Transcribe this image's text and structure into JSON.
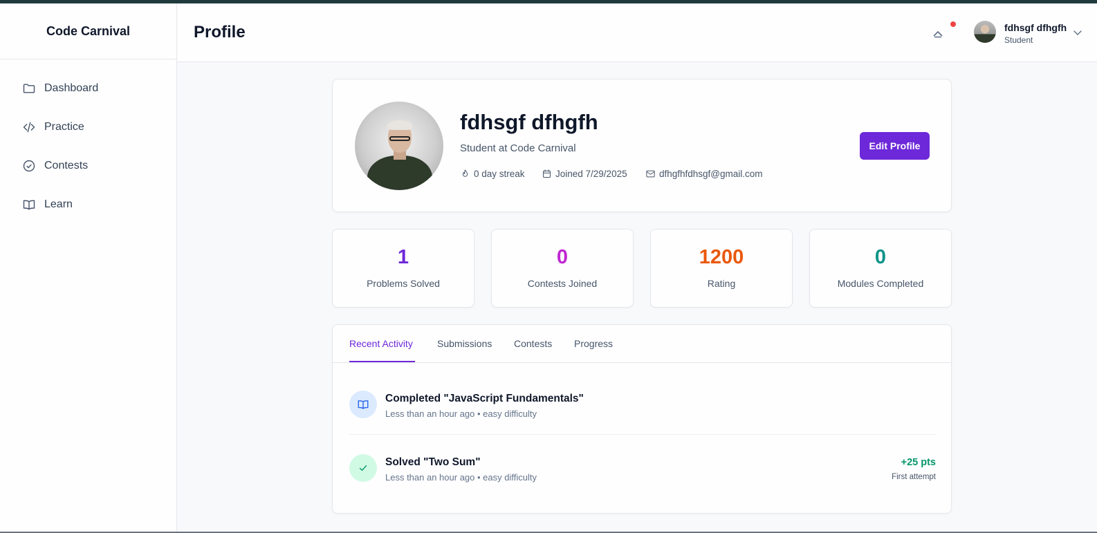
{
  "app": {
    "brand": "Code Carnival"
  },
  "sidebar": {
    "items": [
      {
        "label": "Dashboard",
        "icon": "folder-icon"
      },
      {
        "label": "Practice",
        "icon": "code-icon"
      },
      {
        "label": "Contests",
        "icon": "check-circle-icon"
      },
      {
        "label": "Learn",
        "icon": "book-open-icon"
      }
    ]
  },
  "header": {
    "title": "Profile",
    "user": {
      "name": "fdhsgf dfhgfh",
      "role": "Student"
    },
    "notification_dot_color": "#ef4444"
  },
  "profile": {
    "name": "fdhsgf dfhgfh",
    "subtitle": "Student at Code Carnival",
    "streak": "0 day streak",
    "joined": "Joined 7/29/2025",
    "email": "dfhgfhfdhsgf@gmail.com",
    "edit_label": "Edit Profile"
  },
  "stats": [
    {
      "value": "1",
      "label": "Problems Solved",
      "color": "#6d28d9"
    },
    {
      "value": "0",
      "label": "Contests Joined",
      "color": "#c026d3"
    },
    {
      "value": "1200",
      "label": "Rating",
      "color": "#ea580c"
    },
    {
      "value": "0",
      "label": "Modules Completed",
      "color": "#0d9488"
    }
  ],
  "tabs": [
    {
      "label": "Recent Activity",
      "active": true
    },
    {
      "label": "Submissions",
      "active": false
    },
    {
      "label": "Contests",
      "active": false
    },
    {
      "label": "Progress",
      "active": false
    }
  ],
  "activity": [
    {
      "title": "Completed \"JavaScript Fundamentals\"",
      "subtitle": "Less than an hour ago • easy difficulty",
      "icon": "book-open-icon"
    },
    {
      "title": "Solved \"Two Sum\"",
      "subtitle": "Less than an hour ago • easy difficulty",
      "icon": "check-icon",
      "points": "+25 pts",
      "note": "First attempt"
    }
  ],
  "colors": {
    "accent": "#6d28d9",
    "success": "#059669"
  }
}
